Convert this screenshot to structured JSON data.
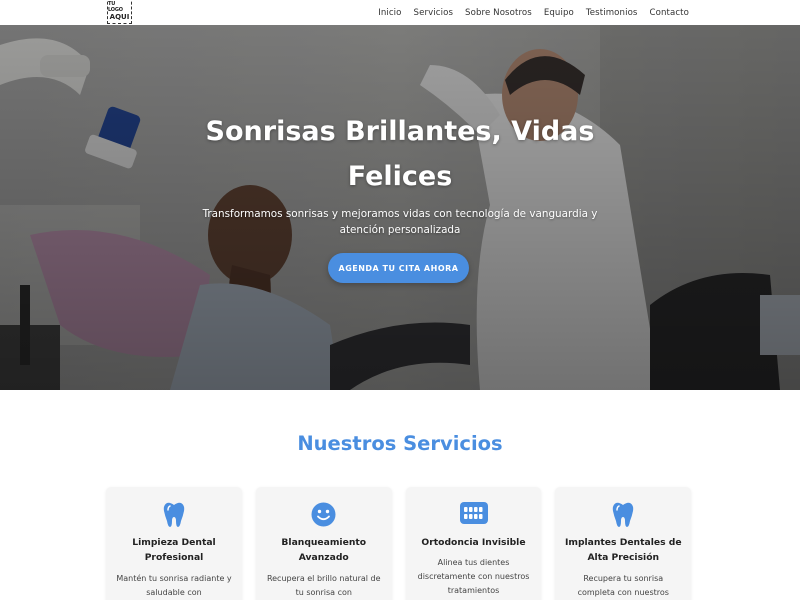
{
  "brand": {
    "logo_line1": "TU LOGO",
    "logo_line2": "AQUI"
  },
  "nav": {
    "items": [
      {
        "label": "Inicio"
      },
      {
        "label": "Servicios"
      },
      {
        "label": "Sobre Nosotros"
      },
      {
        "label": "Equipo"
      },
      {
        "label": "Testimonios"
      },
      {
        "label": "Contacto"
      }
    ]
  },
  "hero": {
    "title": "Sonrisas Brillantes, Vidas Felices",
    "subtitle": "Transformamos sonrisas y mejoramos vidas con tecnología de vanguardia y atención personalizada",
    "cta_label": "AGENDA TU CITA AHORA"
  },
  "services": {
    "title": "Nuestros Servicios",
    "cards": [
      {
        "icon": "tooth-icon",
        "title": "Limpieza Dental Profesional",
        "description": "Mantén tu sonrisa radiante y saludable con"
      },
      {
        "icon": "smile-icon",
        "title": "Blanqueamiento Avanzado",
        "description": "Recupera el brillo natural de tu sonrisa con"
      },
      {
        "icon": "teeth-icon",
        "title": "Ortodoncia Invisible",
        "description": "Alinea tus dientes discretamente con nuestros tratamientos"
      },
      {
        "icon": "tooth-icon",
        "title": "Implantes Dentales de Alta Precisión",
        "description": "Recupera tu sonrisa completa con nuestros"
      }
    ]
  },
  "colors": {
    "accent": "#4a8ee0",
    "card_bg": "#f5f5f5",
    "nav_text": "#333333"
  }
}
